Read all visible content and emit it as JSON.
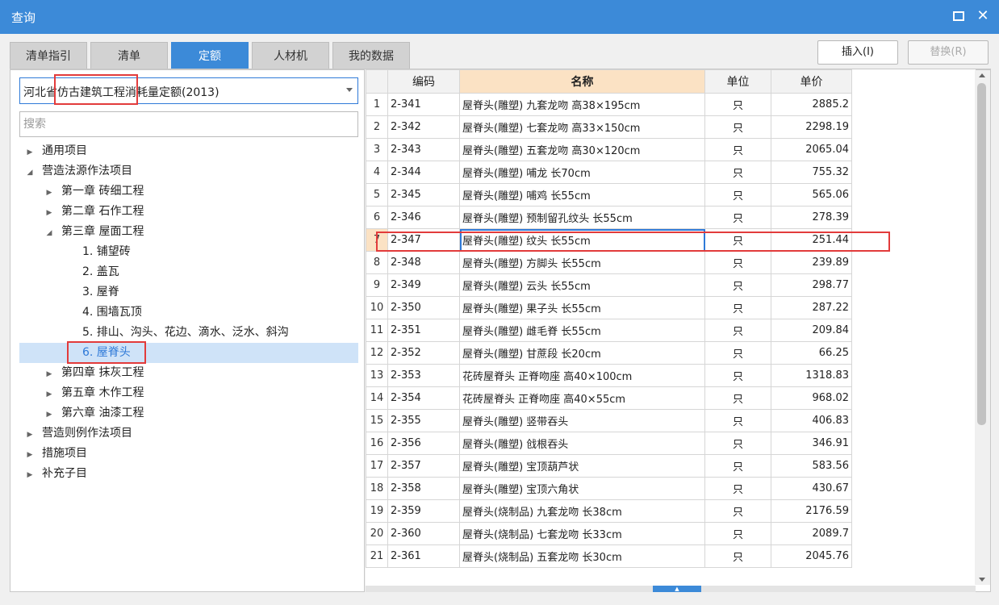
{
  "window": {
    "title": "查询",
    "maximize_icon": "maximize-icon",
    "close_icon": "close-icon",
    "close_glyph": "✕"
  },
  "tabs": [
    {
      "label": "清单指引",
      "active": false
    },
    {
      "label": "清单",
      "active": false
    },
    {
      "label": "定额",
      "active": true
    },
    {
      "label": "人材机",
      "active": false
    },
    {
      "label": "我的数据",
      "active": false
    }
  ],
  "actions": {
    "insert_label": "插入(I)",
    "replace_label": "替换(R)"
  },
  "library": {
    "selected": "河北省仿古建筑工程消耗量定额(2013)"
  },
  "search": {
    "placeholder": "搜索",
    "value": ""
  },
  "tree": [
    {
      "label": "通用项目",
      "level": 0,
      "caret": "right"
    },
    {
      "label": "营造法源作法项目",
      "level": 0,
      "caret": "down"
    },
    {
      "label": "第一章 砖细工程",
      "level": 1,
      "caret": "right"
    },
    {
      "label": "第二章 石作工程",
      "level": 1,
      "caret": "right"
    },
    {
      "label": "第三章 屋面工程",
      "level": 1,
      "caret": "down"
    },
    {
      "label": "1. 铺望砖",
      "level": 2,
      "caret": ""
    },
    {
      "label": "2. 盖瓦",
      "level": 2,
      "caret": ""
    },
    {
      "label": "3. 屋脊",
      "level": 2,
      "caret": ""
    },
    {
      "label": "4. 围墙瓦顶",
      "level": 2,
      "caret": ""
    },
    {
      "label": "5. 排山、沟头、花边、滴水、泛水、斜沟",
      "level": 2,
      "caret": ""
    },
    {
      "label": "6. 屋脊头",
      "level": 2,
      "caret": "",
      "selected": true
    },
    {
      "label": "第四章 抹灰工程",
      "level": 1,
      "caret": "right"
    },
    {
      "label": "第五章 木作工程",
      "level": 1,
      "caret": "right"
    },
    {
      "label": "第六章 油漆工程",
      "level": 1,
      "caret": "right"
    },
    {
      "label": "营造则例作法项目",
      "level": 0,
      "caret": "right"
    },
    {
      "label": "措施项目",
      "level": 0,
      "caret": "right"
    },
    {
      "label": "补充子目",
      "level": 0,
      "caret": "right"
    }
  ],
  "table": {
    "columns": [
      "编码",
      "名称",
      "单位",
      "单价"
    ],
    "current_row": 7,
    "rows": [
      [
        "1",
        "2-341",
        "屋脊头(雕塑) 九套龙吻 高38×195cm",
        "只",
        "2885.2"
      ],
      [
        "2",
        "2-342",
        "屋脊头(雕塑) 七套龙吻 高33×150cm",
        "只",
        "2298.19"
      ],
      [
        "3",
        "2-343",
        "屋脊头(雕塑) 五套龙吻 高30×120cm",
        "只",
        "2065.04"
      ],
      [
        "4",
        "2-344",
        "屋脊头(雕塑) 哺龙 长70cm",
        "只",
        "755.32"
      ],
      [
        "5",
        "2-345",
        "屋脊头(雕塑) 哺鸡 长55cm",
        "只",
        "565.06"
      ],
      [
        "6",
        "2-346",
        "屋脊头(雕塑) 预制留孔纹头 长55cm",
        "只",
        "278.39"
      ],
      [
        "7",
        "2-347",
        "屋脊头(雕塑) 纹头 长55cm",
        "只",
        "251.44"
      ],
      [
        "8",
        "2-348",
        "屋脊头(雕塑) 方脚头 长55cm",
        "只",
        "239.89"
      ],
      [
        "9",
        "2-349",
        "屋脊头(雕塑) 云头 长55cm",
        "只",
        "298.77"
      ],
      [
        "10",
        "2-350",
        "屋脊头(雕塑) 果子头 长55cm",
        "只",
        "287.22"
      ],
      [
        "11",
        "2-351",
        "屋脊头(雕塑) 雌毛脊 长55cm",
        "只",
        "209.84"
      ],
      [
        "12",
        "2-352",
        "屋脊头(雕塑) 甘蔗段 长20cm",
        "只",
        "66.25"
      ],
      [
        "13",
        "2-353",
        "花砖屋脊头 正脊吻座 高40×100cm",
        "只",
        "1318.83"
      ],
      [
        "14",
        "2-354",
        "花砖屋脊头 正脊吻座 高40×55cm",
        "只",
        "968.02"
      ],
      [
        "15",
        "2-355",
        "屋脊头(雕塑) 竖带吞头",
        "只",
        "406.83"
      ],
      [
        "16",
        "2-356",
        "屋脊头(雕塑) 戗根吞头",
        "只",
        "346.91"
      ],
      [
        "17",
        "2-357",
        "屋脊头(雕塑) 宝顶葫芦状",
        "只",
        "583.56"
      ],
      [
        "18",
        "2-358",
        "屋脊头(雕塑) 宝顶六角状",
        "只",
        "430.67"
      ],
      [
        "19",
        "2-359",
        "屋脊头(烧制品) 九套龙吻 长38cm",
        "只",
        "2176.59"
      ],
      [
        "20",
        "2-360",
        "屋脊头(烧制品) 七套龙吻 长33cm",
        "只",
        "2089.7"
      ],
      [
        "21",
        "2-361",
        "屋脊头(烧制品) 五套龙吻 长30cm",
        "只",
        "2045.76"
      ]
    ]
  },
  "scrollbar": {
    "grip_glyph": "▲"
  },
  "colors": {
    "accent": "#3c8ad8",
    "highlight_box": "#e23b3b",
    "selected_row": "#cfe3f8",
    "header_accent": "#fbe2c4"
  }
}
